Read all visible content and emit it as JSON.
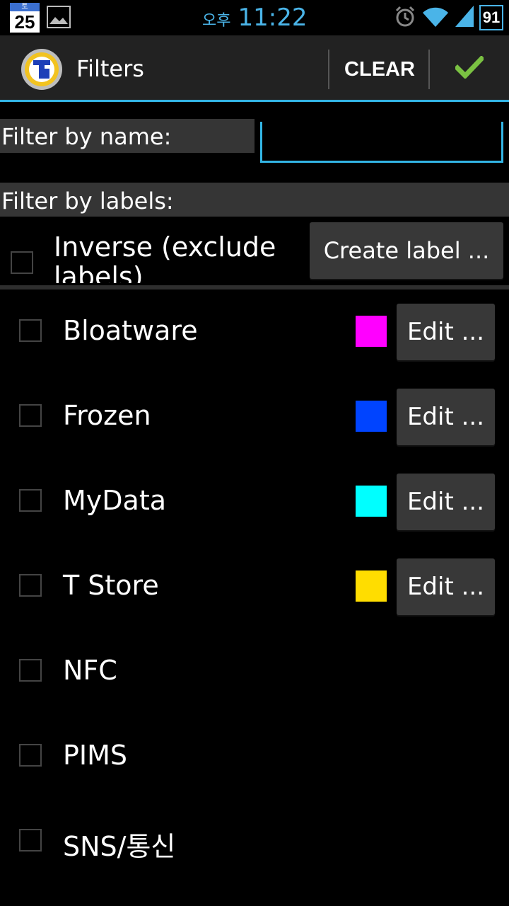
{
  "status_bar": {
    "calendar_weekday": "토",
    "calendar_day": "25",
    "ampm": "오후",
    "time": "11:22",
    "battery": "91",
    "icons": [
      "calendar-icon",
      "picture-icon",
      "alarm-icon",
      "wifi-icon",
      "signal-icon",
      "battery-icon"
    ]
  },
  "action_bar": {
    "title": "Filters",
    "clear_label": "CLEAR",
    "confirm_icon": "checkmark-icon",
    "accent_color": "#33b5e5",
    "check_color": "#7ac142"
  },
  "filter_name": {
    "label": "Filter by name:",
    "value": "",
    "placeholder": ""
  },
  "filter_labels": {
    "label": "Filter by labels:",
    "inverse_label": "Inverse (exclude labels)",
    "inverse_checked": false,
    "create_label_button": "Create label ..."
  },
  "labels": [
    {
      "name": "Bloatware",
      "color": "#ff00ff",
      "edit": "Edit ...",
      "checked": false
    },
    {
      "name": "Frozen",
      "color": "#0044ff",
      "edit": "Edit ...",
      "checked": false
    },
    {
      "name": "MyData",
      "color": "#00ffff",
      "edit": "Edit ...",
      "checked": false
    },
    {
      "name": "T Store",
      "color": "#ffdd00",
      "edit": "Edit ...",
      "checked": false
    },
    {
      "name": "NFC",
      "checked": false
    },
    {
      "name": "PIMS",
      "checked": false
    },
    {
      "name": "SNS/통신",
      "checked": false
    }
  ]
}
